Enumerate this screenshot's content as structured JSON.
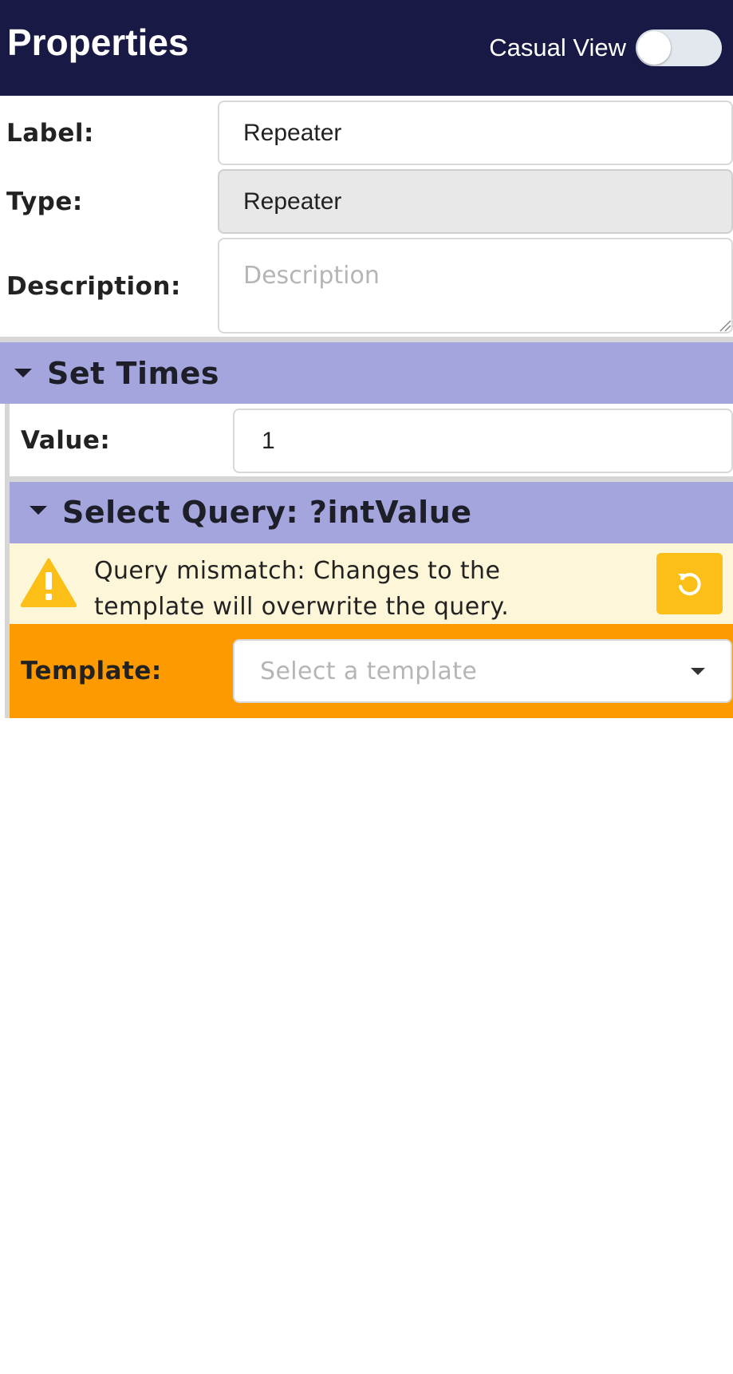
{
  "header": {
    "title": "Properties",
    "casual_view_label": "Casual View",
    "casual_view_on": false
  },
  "properties": {
    "label_label": "Label:",
    "label_value": "Repeater",
    "type_label": "Type:",
    "type_value": "Repeater",
    "description_label": "Description:",
    "description_placeholder": "Description"
  },
  "set_times": {
    "title": "Set Times",
    "value_label": "Value:",
    "value": "1",
    "select_query": {
      "title": "Select Query: ?intValue",
      "warning": {
        "text": "Query mismatch: Changes to the template will overwrite the query.",
        "icon": "warning-triangle-icon",
        "reset_icon": "reset-icon"
      },
      "template_label": "Template:",
      "template_placeholder": "Select a template"
    }
  },
  "colors": {
    "header_bg": "#181944",
    "section_bg": "#a3a5dc",
    "warning_bg": "#fdf6d8",
    "warning_icon": "#fbbf17",
    "template_row_bg": "#fd9a00"
  }
}
